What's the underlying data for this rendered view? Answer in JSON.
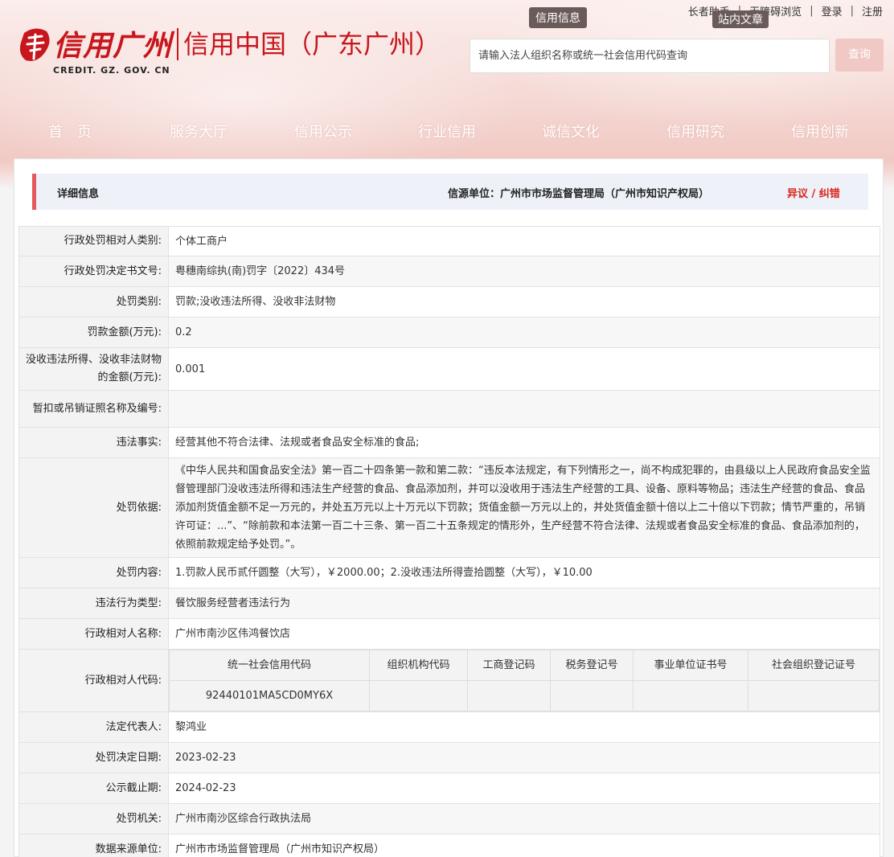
{
  "topbar": {
    "elder_assistant": "长者助手",
    "accessibility": "无障碍浏览",
    "login": "登录",
    "register": "注册",
    "tag_credit_info": "信用信息",
    "tag_site_article": "站内文章"
  },
  "logo": {
    "name": "信用广州",
    "url": "CREDIT. GZ. GOV. CN",
    "subtitle": "信用中国（广东广州）"
  },
  "search": {
    "placeholder": "请输入法人组织名称或统一社会信用代码查询",
    "button": "查询"
  },
  "nav": [
    "首　页",
    "服务大厅",
    "信用公示",
    "行业信用",
    "诚信文化",
    "信用研究",
    "信用创新"
  ],
  "header": {
    "title": "详细信息",
    "source": "信源单位：广州市市场监督管理局（广州市知识产权局）",
    "objection": "异议 / 纠错"
  },
  "rows": {
    "r1": {
      "label": "行政处罚相对人类别:",
      "value": "个体工商户"
    },
    "r2": {
      "label": "行政处罚决定书文号:",
      "value": "粤穗南综执(南)罚字〔2022〕434号"
    },
    "r3": {
      "label": "处罚类别:",
      "value": "罚款;没收违法所得、没收非法财物"
    },
    "r4": {
      "label": "罚款金额(万元):",
      "value": "0.2"
    },
    "r5": {
      "label": "没收违法所得、没收非法财物的金额(万元):",
      "value": "0.001"
    },
    "r6": {
      "label": "暂扣或吊销证照名称及编号:",
      "value": ""
    },
    "r7": {
      "label": "违法事实:",
      "value": "经营其他不符合法律、法规或者食品安全标准的食品;"
    },
    "r8": {
      "label": "处罚依据:",
      "value": "《中华人民共和国食品安全法》第一百二十四条第一款和第二款：“违反本法规定，有下列情形之一，尚不构成犯罪的，由县级以上人民政府食品安全监督管理部门没收违法所得和违法生产经营的食品、食品添加剂，并可以没收用于违法生产经营的工具、设备、原料等物品；违法生产经营的食品、食品添加剂货值金额不足一万元的，并处五万元以上十万元以下罚款；货值金额一万元以上的，并处货值金额十倍以上二十倍以下罚款；情节严重的，吊销许可证：...”、“除前款和本法第一百二十三条、第一百二十五条规定的情形外，生产经营不符合法律、法规或者食品安全标准的食品、食品添加剂的，依照前款规定给予处罚。”。"
    },
    "r9": {
      "label": "处罚内容:",
      "value": "1.罚款人民币贰仟圆整（大写），￥2000.00；2.没收违法所得壹拾圆整（大写），￥10.00"
    },
    "r10": {
      "label": "违法行为类型:",
      "value": "餐饮服务经营者违法行为"
    },
    "r11": {
      "label": "行政相对人名称:",
      "value": "广州市南沙区伟鸿餐饮店"
    },
    "r12": {
      "label": "行政相对人代码:"
    },
    "r13": {
      "label": "法定代表人:",
      "value": "黎鸿业"
    },
    "r14": {
      "label": "处罚决定日期:",
      "value": "2023-02-23"
    },
    "r15": {
      "label": "公示截止期:",
      "value": "2024-02-23"
    },
    "r16": {
      "label": "处罚机关:",
      "value": "广州市南沙区综合行政执法局"
    },
    "r17": {
      "label": "数据来源单位:",
      "value": "广州市市场监督管理局（广州市知识产权局）"
    }
  },
  "codes": {
    "headers": [
      "统一社会信用代码",
      "组织机构代码",
      "工商登记码",
      "税务登记号",
      "事业单位证书号",
      "社会组织登记证号"
    ],
    "values": [
      "92440101MA5CD0MY6X",
      "",
      "",
      "",
      "",
      ""
    ]
  },
  "colors": {
    "brand_red": "#c8161d",
    "accent_bar": "#e5585b",
    "objection_red": "#d9261c"
  }
}
